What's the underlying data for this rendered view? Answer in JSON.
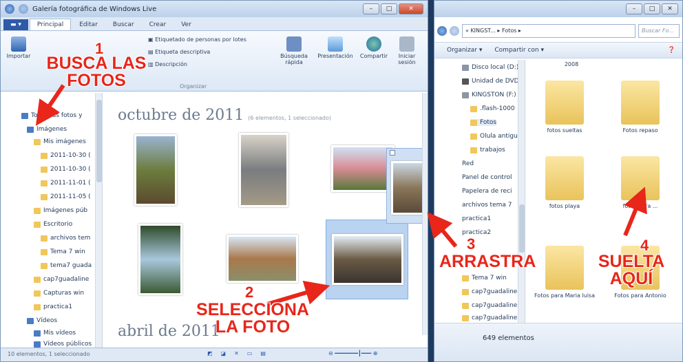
{
  "gallery": {
    "title": "Galería fotográfica de Windows Live",
    "tabs": [
      "Principal",
      "Editar",
      "Buscar",
      "Crear",
      "Ver"
    ],
    "ribbon": {
      "importar": "Importar",
      "etiquetado": "Etiquetado de personas por lotes",
      "etiqueta": "Etiqueta descriptiva",
      "descripcion": "Descripción",
      "busqueda": "Búsqueda rápida",
      "presentacion": "Presentación",
      "compartir": "Compartir",
      "iniciar": "Iniciar sesión",
      "organizar": "Organizar"
    },
    "nav": [
      "Todas las fotos y",
      "Imágenes",
      "Mis imágenes",
      "2011-10-30 (",
      "2011-10-30 (",
      "2011-11-01 (",
      "2011-11-05 (",
      "Imágenes púb",
      "Escritorio",
      "archivos tem",
      "Tema 7 win",
      "tema7 guada",
      "cap7guadaline",
      "Capturas win",
      "practica1",
      "Vídeos",
      "Mis vídeos",
      "Vídeos públicos"
    ],
    "header1": "octubre de 2011",
    "header1_note": "(6 elementos, 1 seleccionado)",
    "header2": "abril de 2011",
    "status": "10 elementos, 1 seleccionado"
  },
  "explorer": {
    "address": "« KINGST... ▸ Fotos ▸",
    "search_placeholder": "Buscar Fo...",
    "organizar": "Organizar ▾",
    "compartir": "Compartir con ▾",
    "nav": [
      "Disco local (D:)",
      "Unidad de DVD",
      "KINGSTON (F:)",
      ".flash-1000",
      "Fotos",
      "Olula antigua",
      "trabajos",
      "Red",
      "Panel de control",
      "Papelera de reci",
      "archivos tema 7",
      "practica1",
      "practica2",
      "Tema 7 win",
      "cap7guadaline",
      "cap7guadaline",
      "cap7guadaline"
    ],
    "year": "2008",
    "folders": [
      "fotos sueltas",
      "Fotos repaso",
      "fotos playa",
      "fotos para ...",
      "Fotos para Maria luisa",
      "Fotos para Antonio"
    ],
    "count": "649 elementos"
  },
  "annotations": {
    "a1_num": "1",
    "a1": "BUSCA LAS FOTOS",
    "a2_num": "2",
    "a2": "SELECCIONA LA FOTO",
    "a3_num": "3",
    "a3": "ARRASTRA",
    "a4_num": "4",
    "a4": "SUELTA AQUÍ"
  }
}
